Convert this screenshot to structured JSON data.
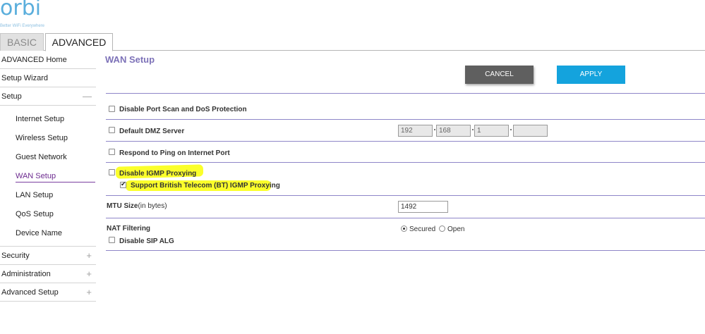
{
  "logo": {
    "text": "orbi",
    "tagline": "Better WiFi Everywhere"
  },
  "tabs": [
    {
      "label": "BASIC"
    },
    {
      "label": "ADVANCED"
    }
  ],
  "sidebar": {
    "items": [
      {
        "label": "ADVANCED Home"
      },
      {
        "label": "Setup Wizard"
      },
      {
        "label": "Setup",
        "symbol": "—"
      }
    ],
    "setup_sub": [
      {
        "label": "Internet Setup"
      },
      {
        "label": "Wireless Setup"
      },
      {
        "label": "Guest Network"
      },
      {
        "label": "WAN Setup"
      },
      {
        "label": "LAN Setup"
      },
      {
        "label": "QoS Setup"
      },
      {
        "label": "Device Name"
      }
    ],
    "bottom_items": [
      {
        "label": "Security",
        "symbol": "+"
      },
      {
        "label": "Administration",
        "symbol": "+"
      },
      {
        "label": "Advanced Setup",
        "symbol": "+"
      }
    ]
  },
  "page": {
    "title": "WAN Setup",
    "cancel_label": "CANCEL",
    "apply_label": "APPLY"
  },
  "settings": {
    "port_scan": {
      "label": "Disable Port Scan and DoS Protection",
      "checked": false
    },
    "dmz": {
      "label": "Default DMZ Server",
      "checked": false,
      "ip": [
        "192",
        "168",
        "1",
        ""
      ]
    },
    "ping": {
      "label": "Respond to Ping on Internet Port",
      "checked": false
    },
    "igmp": {
      "label": "Disable IGMP Proxying",
      "checked": false
    },
    "bt_igmp": {
      "label": "Support British Telecom (BT) IGMP Proxying",
      "checked": true
    },
    "mtu": {
      "label": "MTU Size",
      "unit": "(in bytes)",
      "value": "1492"
    },
    "nat": {
      "label": "NAT Filtering",
      "options": [
        "Secured",
        "Open"
      ],
      "selected": "Secured"
    },
    "sip": {
      "label": "Disable SIP ALG",
      "checked": false
    }
  },
  "colors": {
    "highlight": "#fbff2b",
    "accent_line": "#8e86c8",
    "apply": "#14a3dd",
    "cancel": "#5f5f5f",
    "title": "#7d72b8"
  }
}
